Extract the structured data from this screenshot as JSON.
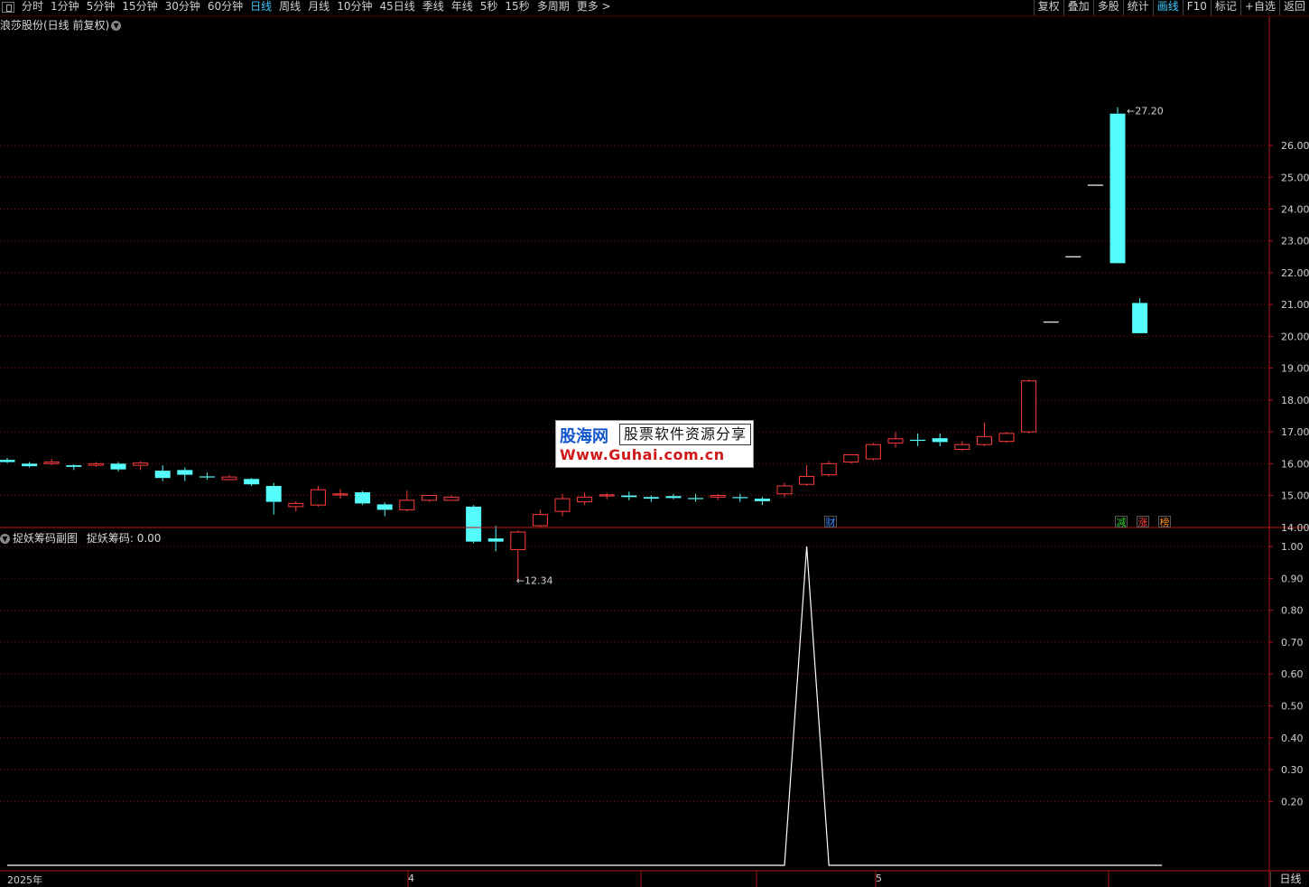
{
  "toolbar": {
    "periods": [
      "分时",
      "1分钟",
      "5分钟",
      "15分钟",
      "30分钟",
      "60分钟",
      "日线",
      "周线",
      "月线",
      "10分钟",
      "45日线",
      "季线",
      "年线",
      "5秒",
      "15秒",
      "多周期",
      "更多 >"
    ],
    "active_period": "日线",
    "right_buttons": [
      "复权",
      "叠加",
      "多股",
      "统计",
      "画线",
      "F10",
      "标记",
      "+自选",
      "返回"
    ],
    "highlighted_right": "画线"
  },
  "chart": {
    "title": "浪莎股份(日线 前复权)",
    "high_label": "27.20",
    "low_label": "12.34",
    "event_tags": [
      {
        "text": "财",
        "color": "#3a8cff"
      },
      {
        "text": "减",
        "color": "#33cc33"
      },
      {
        "text": "涨",
        "color": "#ff4040"
      },
      {
        "text": "榜",
        "color": "#ff8c1a"
      }
    ]
  },
  "indicator": {
    "title": "捉妖筹码副图",
    "value_label": "捉妖筹码: 0.00"
  },
  "dates": {
    "labels": [
      "2025年",
      "4",
      "5"
    ],
    "period_box": "日线"
  },
  "watermark": {
    "brand": "股海网",
    "slogan": "股票软件资源分享",
    "url": "Www.Guhai.com.cn"
  },
  "chart_data": [
    {
      "type": "candlestick",
      "title": "浪莎股份(日线 前复权)",
      "y_ticks": [
        "14.00",
        "15.00",
        "16.00",
        "17.00",
        "18.00",
        "19.00",
        "20.00",
        "21.00",
        "22.00",
        "23.00",
        "24.00",
        "25.00",
        "26.00"
      ],
      "ylim": [
        12.0,
        27.4
      ],
      "grid": true,
      "colors": {
        "up": "#ff3c3c",
        "down": "#54fcfc"
      },
      "candles": [
        [
          16.12,
          16.05,
          16.18,
          16.02
        ],
        [
          16.0,
          15.92,
          16.05,
          15.88
        ],
        [
          16.0,
          16.05,
          16.15,
          15.95
        ],
        [
          15.95,
          15.9,
          15.98,
          15.8
        ],
        [
          15.95,
          16.0,
          16.05,
          15.9
        ],
        [
          16.0,
          15.82,
          16.05,
          15.75
        ],
        [
          15.95,
          16.02,
          16.08,
          15.8
        ],
        [
          15.78,
          15.55,
          15.95,
          15.45
        ],
        [
          15.8,
          15.65,
          15.88,
          15.45
        ],
        [
          15.6,
          15.58,
          15.72,
          15.5
        ],
        [
          15.5,
          15.58,
          15.65,
          15.48
        ],
        [
          15.52,
          15.35,
          15.55,
          15.3
        ],
        [
          15.3,
          14.8,
          15.4,
          14.4
        ],
        [
          14.65,
          14.75,
          14.82,
          14.5
        ],
        [
          14.7,
          15.18,
          15.3,
          14.65
        ],
        [
          15.05,
          15.05,
          15.2,
          14.9
        ],
        [
          15.1,
          14.75,
          15.15,
          14.7
        ],
        [
          14.72,
          14.55,
          14.78,
          14.35
        ],
        [
          14.55,
          14.85,
          15.15,
          14.5
        ],
        [
          14.85,
          15.0,
          15.02,
          14.8
        ],
        [
          14.85,
          14.95,
          15.0,
          14.85
        ],
        [
          14.65,
          13.55,
          14.7,
          13.5
        ],
        [
          13.65,
          13.55,
          14.05,
          13.25
        ],
        [
          13.3,
          13.85,
          13.9,
          12.34
        ],
        [
          14.05,
          14.4,
          14.55,
          14.0
        ],
        [
          14.5,
          14.9,
          15.05,
          14.35
        ],
        [
          14.8,
          14.95,
          15.1,
          14.7
        ],
        [
          15.0,
          15.02,
          15.08,
          14.88
        ],
        [
          15.0,
          14.95,
          15.12,
          14.85
        ],
        [
          14.95,
          14.9,
          15.0,
          14.8
        ],
        [
          14.98,
          14.92,
          15.05,
          14.88
        ],
        [
          14.92,
          14.9,
          15.05,
          14.8
        ],
        [
          14.95,
          15.0,
          15.05,
          14.85
        ],
        [
          14.95,
          14.92,
          15.05,
          14.8
        ],
        [
          14.9,
          14.82,
          14.95,
          14.7
        ],
        [
          15.05,
          15.3,
          15.4,
          14.95
        ],
        [
          15.35,
          15.6,
          15.95,
          15.3
        ],
        [
          15.65,
          16.0,
          16.08,
          15.6
        ],
        [
          16.05,
          16.28,
          16.3,
          16.0
        ],
        [
          16.15,
          16.6,
          16.65,
          16.1
        ],
        [
          16.65,
          16.78,
          17.0,
          16.5
        ],
        [
          16.75,
          16.72,
          16.95,
          16.55
        ],
        [
          16.8,
          16.68,
          16.95,
          16.55
        ],
        [
          16.45,
          16.6,
          16.7,
          16.4
        ],
        [
          16.6,
          16.85,
          17.3,
          16.55
        ],
        [
          16.7,
          16.95,
          17.0,
          16.65
        ],
        [
          17.0,
          18.6,
          18.65,
          16.95
        ],
        [
          20.45,
          20.45,
          20.45,
          20.45
        ],
        [
          22.5,
          22.5,
          22.5,
          22.5
        ],
        [
          24.75,
          24.75,
          24.75,
          24.75
        ],
        [
          27.0,
          22.3,
          27.2,
          22.3
        ],
        [
          21.05,
          20.1,
          21.2,
          20.1
        ]
      ]
    },
    {
      "type": "line",
      "title": "捉妖筹码副图",
      "series_name": "捉妖筹码",
      "y_ticks": [
        "0.20",
        "0.30",
        "0.40",
        "0.50",
        "0.60",
        "0.70",
        "0.80",
        "0.90",
        "1.00"
      ],
      "ylim": [
        0.0,
        1.0
      ],
      "values": [
        0,
        0,
        0,
        0,
        0,
        0,
        0,
        0,
        0,
        0,
        0,
        0,
        0,
        0,
        0,
        0,
        0,
        0,
        0,
        0,
        0,
        0,
        0,
        0,
        0,
        0,
        0,
        0,
        0,
        0,
        0,
        0,
        0,
        0,
        0,
        0,
        1,
        0,
        0,
        0,
        0,
        0,
        0,
        0,
        0,
        0,
        0,
        0,
        0,
        0,
        0,
        0,
        0
      ]
    }
  ]
}
